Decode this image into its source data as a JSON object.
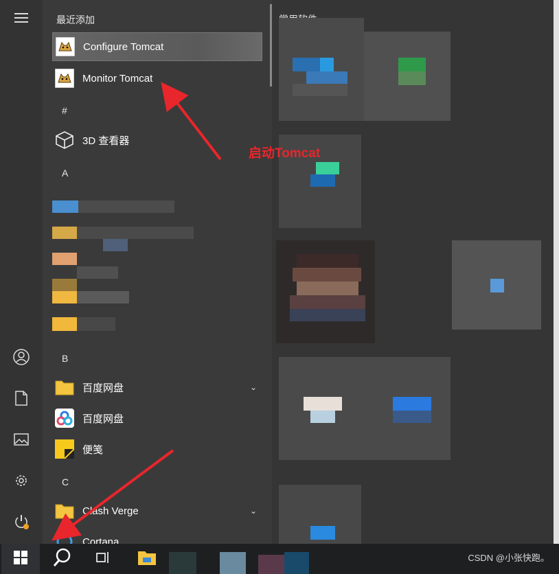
{
  "recently_added_header": "最近添加",
  "recent": [
    {
      "label": "Configure Tomcat",
      "icon": "tomcat-icon"
    },
    {
      "label": "Monitor Tomcat",
      "icon": "tomcat-icon"
    }
  ],
  "sections": {
    "hash": "#",
    "a": "A",
    "b": "B",
    "c": "C"
  },
  "apps": {
    "viewer3d": {
      "label": "3D 查看器",
      "icon": "cube-icon"
    },
    "baidu_folder": {
      "label": "百度网盘",
      "icon": "folder-icon"
    },
    "baidu_app": {
      "label": "百度网盘",
      "icon": "baidu-netdisk-icon"
    },
    "sticky": {
      "label": "便笺",
      "icon": "sticky-notes-icon"
    },
    "clash_folder": {
      "label": "Clash Verge",
      "icon": "folder-icon"
    },
    "cortana": {
      "label": "Cortana",
      "icon": "cortana-icon"
    }
  },
  "tiles_header": "常用软件",
  "annotation": "启动Tomcat",
  "watermark": "CSDN @小张快跑。",
  "colors": {
    "accent_red": "#e8262b",
    "rail_bg": "#333333",
    "list_bg": "#3a3a3a",
    "taskbar_bg": "#1e1f20"
  }
}
